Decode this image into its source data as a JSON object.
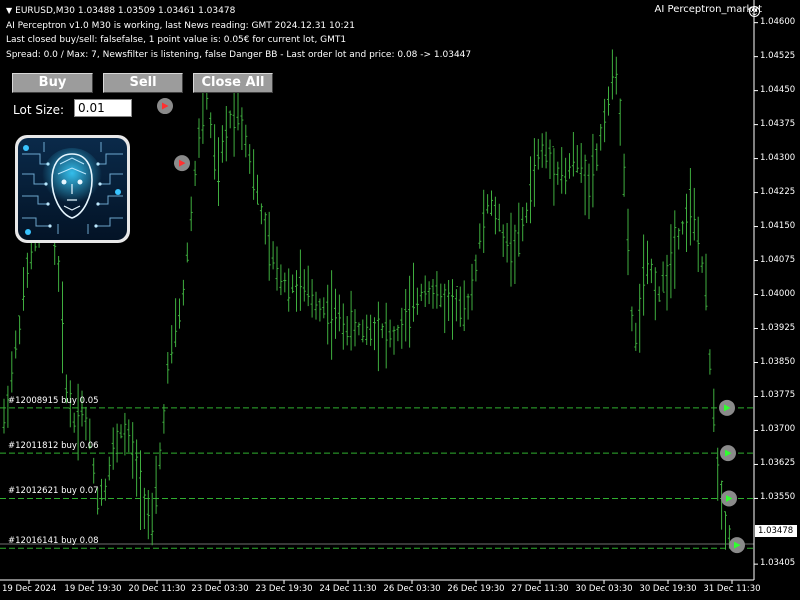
{
  "header": {
    "symbol_line": "EURUSD,M30  1.03488 1.03509 1.03461 1.03478",
    "status_line": "AI Perceptron v1.0 M30 is working, last News reading: GMT 2024.12.31 10:21",
    "last_closed_line": "Last closed buy/sell: falsefalse, 1 point value is: 0.05€ for current lot, GMT1",
    "spread_line": "Spread: 0.0 / Max: 7, Newsfilter is listening, false Danger BB - Last order lot and price: 0.08 -> 1.03447"
  },
  "ea": {
    "name": "AI Perceptron_market",
    "icon": "smiley-icon"
  },
  "controls": {
    "buy_label": "Buy",
    "sell_label": "Sell",
    "close_all_label": "Close All",
    "lot_label": "Lot Size:",
    "lot_value": "0.01"
  },
  "orders": [
    {
      "label": "#12008915 buy 0.05",
      "price": 1.0375
    },
    {
      "label": "#12011812 buy 0.06",
      "price": 1.0365
    },
    {
      "label": "#12012621 buy 0.07",
      "price": 1.0355
    },
    {
      "label": "#12016141 buy 0.08",
      "price": 1.0344
    }
  ],
  "price_axis": {
    "ticks": [
      "1.04600",
      "1.04525",
      "1.04450",
      "1.04375",
      "1.04300",
      "1.04225",
      "1.04150",
      "1.04075",
      "1.04000",
      "1.03925",
      "1.03850",
      "1.03775",
      "1.03700",
      "1.03625",
      "1.03550",
      "1.03478",
      "1.03405"
    ],
    "current_price": "1.03478"
  },
  "time_axis": {
    "ticks": [
      "19 Dec 2024",
      "19 Dec 19:30",
      "20 Dec 11:30",
      "23 Dec 03:30",
      "23 Dec 19:30",
      "24 Dec 11:30",
      "26 Dec 03:30",
      "26 Dec 19:30",
      "27 Dec 11:30",
      "30 Dec 03:30",
      "30 Dec 19:30",
      "31 Dec 11:30"
    ]
  },
  "colors": {
    "background": "#000000",
    "candles": "#3fae3f",
    "order_line": "#2fae2f",
    "button": "#9c9c9c"
  },
  "chart_data": {
    "type": "bar",
    "symbol": "EURUSD",
    "timeframe": "M30",
    "ylim": [
      1.0337,
      1.0465
    ],
    "y_ticks": [
      1.046,
      1.04525,
      1.0445,
      1.04375,
      1.043,
      1.04225,
      1.0415,
      1.04075,
      1.04,
      1.03925,
      1.0385,
      1.03775,
      1.037,
      1.03625,
      1.0355,
      1.03478,
      1.03405
    ],
    "x_ticks": [
      "19 Dec 2024",
      "19 Dec 19:30",
      "20 Dec 11:30",
      "23 Dec 03:30",
      "23 Dec 19:30",
      "24 Dec 11:30",
      "26 Dec 03:30",
      "26 Dec 19:30",
      "27 Dec 11:30",
      "30 Dec 03:30",
      "30 Dec 19:30",
      "31 Dec 11:30"
    ],
    "path": [
      [
        0,
        1.0372
      ],
      [
        3,
        1.0388
      ],
      [
        6,
        1.0405
      ],
      [
        9,
        1.0415
      ],
      [
        12,
        1.042
      ],
      [
        14,
        1.0405
      ],
      [
        16,
        1.038
      ],
      [
        18,
        1.0372
      ],
      [
        20,
        1.0375
      ],
      [
        22,
        1.0368
      ],
      [
        24,
        1.0355
      ],
      [
        26,
        1.0358
      ],
      [
        28,
        1.0365
      ],
      [
        30,
        1.037
      ],
      [
        32,
        1.0368
      ],
      [
        34,
        1.0362
      ],
      [
        36,
        1.0355
      ],
      [
        38,
        1.0348
      ],
      [
        40,
        1.0364
      ],
      [
        42,
        1.0383
      ],
      [
        44,
        1.0392
      ],
      [
        46,
        1.04
      ],
      [
        48,
        1.0418
      ],
      [
        50,
        1.0435
      ],
      [
        52,
        1.0444
      ],
      [
        53,
        1.0437
      ],
      [
        54,
        1.043
      ],
      [
        55,
        1.0426
      ],
      [
        56,
        1.0432
      ],
      [
        58,
        1.0439
      ],
      [
        60,
        1.0441
      ],
      [
        62,
        1.0435
      ],
      [
        64,
        1.0426
      ],
      [
        66,
        1.0418
      ],
      [
        68,
        1.041
      ],
      [
        70,
        1.0405
      ],
      [
        73,
        1.0402
      ],
      [
        76,
        1.0402
      ],
      [
        80,
        1.0398
      ],
      [
        84,
        1.0396
      ],
      [
        88,
        1.0393
      ],
      [
        92,
        1.0392
      ],
      [
        96,
        1.0393
      ],
      [
        100,
        1.039
      ],
      [
        104,
        1.0396
      ],
      [
        108,
        1.0402
      ],
      [
        112,
        1.0399
      ],
      [
        116,
        1.0398
      ],
      [
        118,
        1.0395
      ],
      [
        120,
        1.0402
      ],
      [
        122,
        1.0412
      ],
      [
        124,
        1.042
      ],
      [
        126,
        1.0418
      ],
      [
        128,
        1.0413
      ],
      [
        130,
        1.041
      ],
      [
        132,
        1.0412
      ],
      [
        134,
        1.0418
      ],
      [
        136,
        1.0428
      ],
      [
        138,
        1.0432
      ],
      [
        140,
        1.043
      ],
      [
        142,
        1.0428
      ],
      [
        144,
        1.0426
      ],
      [
        146,
        1.043
      ],
      [
        148,
        1.0428
      ],
      [
        150,
        1.0425
      ],
      [
        152,
        1.043
      ],
      [
        154,
        1.044
      ],
      [
        156,
        1.0446
      ],
      [
        157,
        1.045
      ],
      [
        158,
        1.044
      ],
      [
        159,
        1.0425
      ],
      [
        160,
        1.041
      ],
      [
        161,
        1.0395
      ],
      [
        162,
        1.039
      ],
      [
        163,
        1.0396
      ],
      [
        164,
        1.0404
      ],
      [
        166,
        1.0405
      ],
      [
        168,
        1.04
      ],
      [
        170,
        1.0405
      ],
      [
        172,
        1.0412
      ],
      [
        174,
        1.0415
      ],
      [
        176,
        1.042
      ],
      [
        178,
        1.0412
      ],
      [
        180,
        1.04
      ],
      [
        181,
        1.0385
      ],
      [
        182,
        1.0375
      ],
      [
        183,
        1.0362
      ],
      [
        184,
        1.0355
      ],
      [
        185,
        1.035
      ],
      [
        186,
        1.0347
      ]
    ],
    "last_close": 1.03478
  }
}
